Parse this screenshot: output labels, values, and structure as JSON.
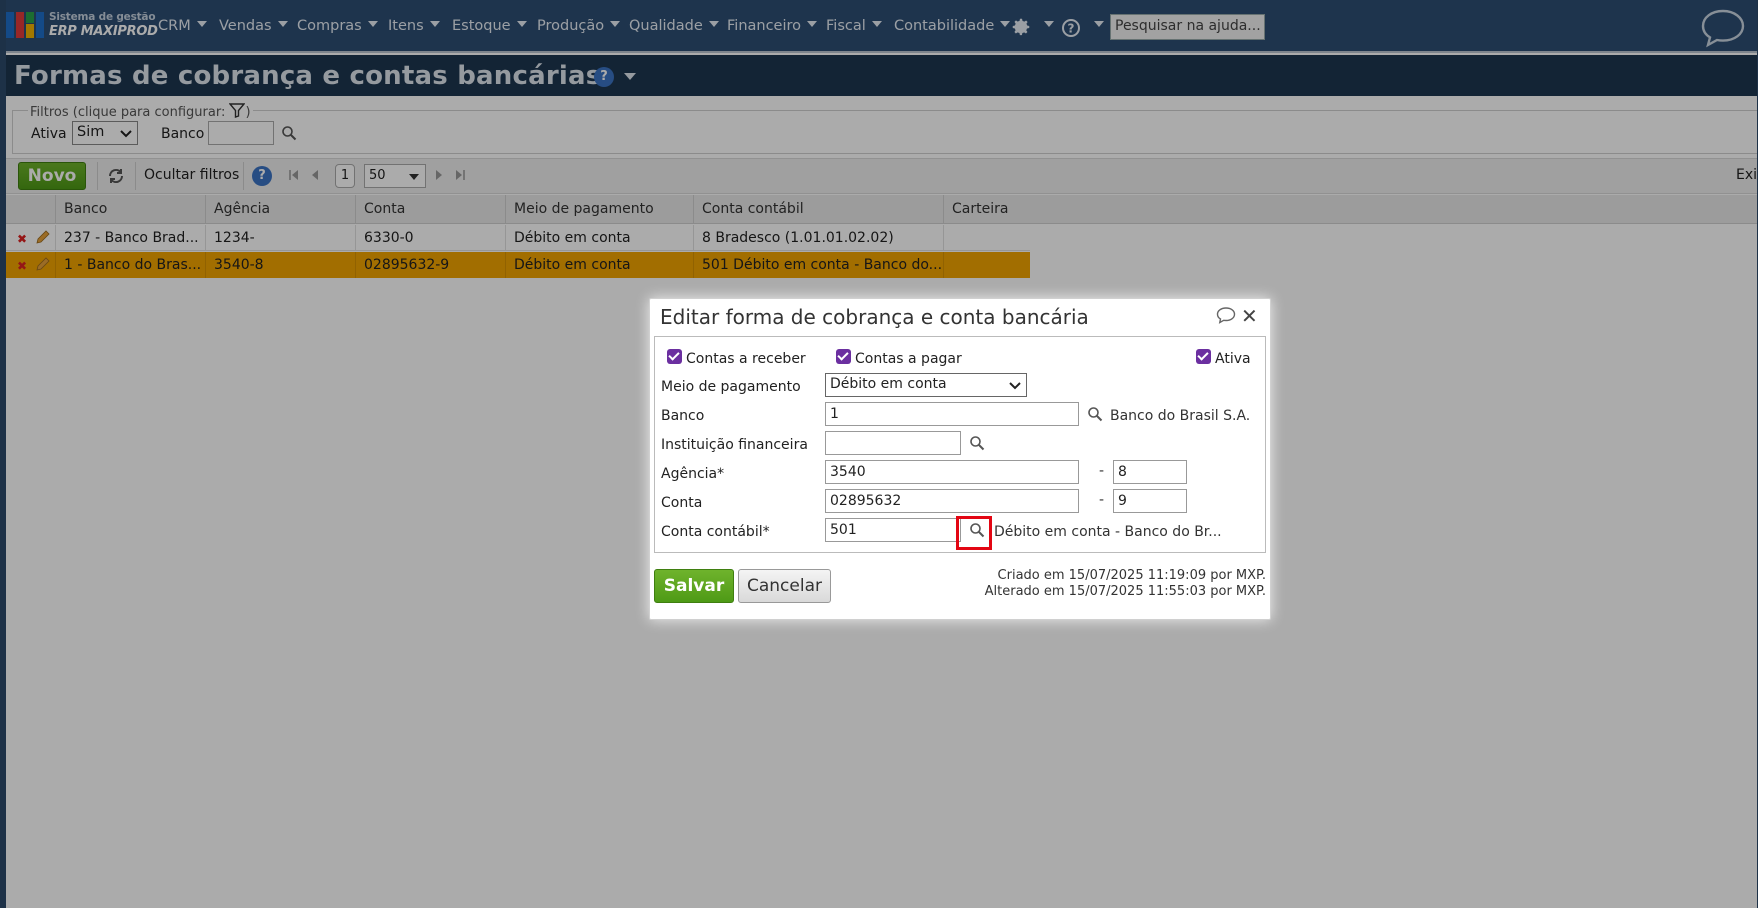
{
  "app": {
    "logo_line1": "Sistema de gestão",
    "logo_line2": "ERP MAXIPROD",
    "search_placeholder": "Pesquisar na ajuda...",
    "colors": {
      "header": "#2d4e74",
      "title_bar": "#1d3650",
      "accent_green": "#5aa51f",
      "highlight_row": "#f2a400",
      "highlight_box": "#e30613",
      "checkbox": "#6b2fa0"
    }
  },
  "nav": {
    "items": [
      {
        "label": "CRM"
      },
      {
        "label": "Vendas"
      },
      {
        "label": "Compras"
      },
      {
        "label": "Itens"
      },
      {
        "label": "Estoque"
      },
      {
        "label": "Produção"
      },
      {
        "label": "Qualidade"
      },
      {
        "label": "Financeiro"
      },
      {
        "label": "Fiscal"
      },
      {
        "label": "Contabilidade"
      }
    ],
    "icons": [
      "gear-icon",
      "help-icon",
      "chat-bubble-icon"
    ]
  },
  "page": {
    "title": "Formas de cobrança e contas bancárias",
    "help_icon": "?"
  },
  "filters": {
    "legend": "Filtros (clique para configurar:",
    "legend_end": ")",
    "ativa_label": "Ativa",
    "ativa_value": "Sim",
    "banco_label": "Banco",
    "banco_value": ""
  },
  "toolbar": {
    "new_label": "Novo",
    "hide_filters_label": "Ocultar filtros",
    "help_icon": "?",
    "page": "1",
    "page_size": "50",
    "right_label": "Exi"
  },
  "grid": {
    "columns": [
      "Banco",
      "Agência",
      "Conta",
      "Meio de pagamento",
      "Conta contábil",
      "Carteira"
    ],
    "rows": [
      {
        "banco": "237 - Banco Brad...",
        "agencia": "1234-",
        "conta": "6330-0",
        "meio": "Débito em conta",
        "conta_contabil": "8 Bradesco (1.01.01.02.02)",
        "carteira": ""
      },
      {
        "banco": "1 - Banco do Bras...",
        "agencia": "3540-8",
        "conta": "02895632-9",
        "meio": "Débito em conta",
        "conta_contabil": "501 Débito em conta - Banco do...",
        "carteira": ""
      }
    ]
  },
  "modal": {
    "title": "Editar forma de cobrança e conta bancária",
    "receber_label": "Contas a receber",
    "pagar_label": "Contas a pagar",
    "ativa_label": "Ativa",
    "meio_label": "Meio de pagamento",
    "meio_value": "Débito em conta",
    "banco_label": "Banco",
    "banco_value": "1",
    "banco_name": "Banco do Brasil S.A.",
    "instituicao_label": "Instituição financeira",
    "instituicao_value": "",
    "agencia_label": "Agência*",
    "agencia_value": "3540",
    "agencia_dv": "8",
    "conta_label": "Conta",
    "conta_value": "02895632",
    "conta_dv": "9",
    "contabil_label": "Conta contábil*",
    "contabil_value": "501",
    "contabil_name": "Débito em conta - Banco do Br...",
    "dash": "-",
    "save_label": "Salvar",
    "cancel_label": "Cancelar",
    "created": "Criado em 15/07/2025 11:19:09 por MXP.",
    "modified": "Alterado em 15/07/2025 11:55:03 por MXP."
  }
}
